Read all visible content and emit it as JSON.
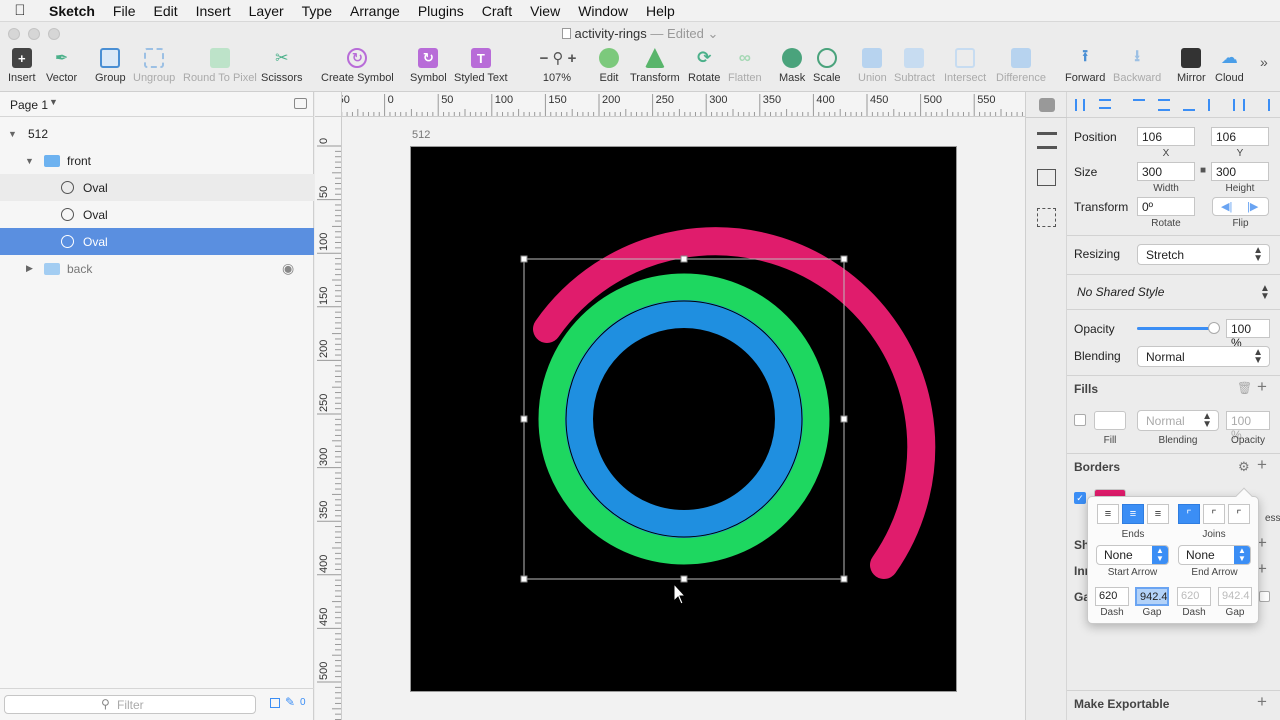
{
  "menubar": {
    "app": "Sketch",
    "items": [
      "File",
      "Edit",
      "Insert",
      "Layer",
      "Type",
      "Arrange",
      "Plugins",
      "Craft",
      "View",
      "Window",
      "Help"
    ]
  },
  "window": {
    "title": "activity-rings",
    "status": "— Edited"
  },
  "toolbar": {
    "insert": "Insert",
    "vector": "Vector",
    "group": "Group",
    "ungroup": "Ungroup",
    "round": "Round To Pixel",
    "scissors": "Scissors",
    "create_symbol": "Create Symbol",
    "symbol": "Symbol",
    "styled_text": "Styled Text",
    "zoom": "107%",
    "edit": "Edit",
    "transform": "Transform",
    "rotate": "Rotate",
    "flatten": "Flatten",
    "mask": "Mask",
    "scale": "Scale",
    "union": "Union",
    "subtract": "Subtract",
    "intersect": "Intersect",
    "difference": "Difference",
    "forward": "Forward",
    "backward": "Backward",
    "mirror": "Mirror",
    "cloud": "Cloud"
  },
  "layers": {
    "page": "Page 1",
    "artboard": "512",
    "front": "front",
    "oval1": "Oval",
    "oval2": "Oval",
    "oval3": "Oval",
    "back": "back",
    "filter_placeholder": "Filter",
    "count": "0"
  },
  "ruler_h": [
    "-50",
    "0",
    "50",
    "100",
    "150",
    "200",
    "250",
    "300",
    "350",
    "400",
    "450",
    "500",
    "550"
  ],
  "ruler_v": [
    "0",
    "50",
    "100",
    "150",
    "200",
    "250",
    "300",
    "350",
    "400",
    "450",
    "500"
  ],
  "canvas": {
    "artboard_label": "512"
  },
  "colors": {
    "pink": "#e01c6c",
    "green": "#1ed760",
    "blue": "#1f8fe0",
    "selection": "#5a8fe0"
  },
  "inspector": {
    "position_label": "Position",
    "pos_x": "106",
    "pos_y": "106",
    "x_label": "X",
    "y_label": "Y",
    "size_label": "Size",
    "width": "300",
    "height": "300",
    "width_label": "Width",
    "height_label": "Height",
    "transform_label": "Transform",
    "rotate_value": "0º",
    "rotate_label": "Rotate",
    "flip_label": "Flip",
    "resizing_label": "Resizing",
    "resizing_value": "Stretch",
    "shared_style": "No Shared Style",
    "opacity_label": "Opacity",
    "opacity_value": "100 %",
    "opacity_level": 1.0,
    "blending_label": "Blending",
    "blending_value": "Normal",
    "fills_label": "Fills",
    "fill_blend": "Normal",
    "fill_opacity": "100 %",
    "fill_sub": "Fill",
    "blend_sub": "Blending",
    "opacity_sub": "Opacity",
    "borders_label": "Borders",
    "thickness_partial": "ess",
    "shadows_partial": "Sh",
    "inner_partial": "Inn",
    "gaussian_partial": "Ga",
    "make_exportable": "Make Exportable"
  },
  "popover": {
    "ends": "Ends",
    "joins": "Joins",
    "start_arrow_value": "None",
    "end_arrow_value": "None",
    "start_arrow": "Start Arrow",
    "end_arrow": "End Arrow",
    "dash1": "620",
    "gap1": "942.4",
    "dash2": "620",
    "gap2": "942.4",
    "dash_label": "Dash",
    "gap_label": "Gap"
  }
}
